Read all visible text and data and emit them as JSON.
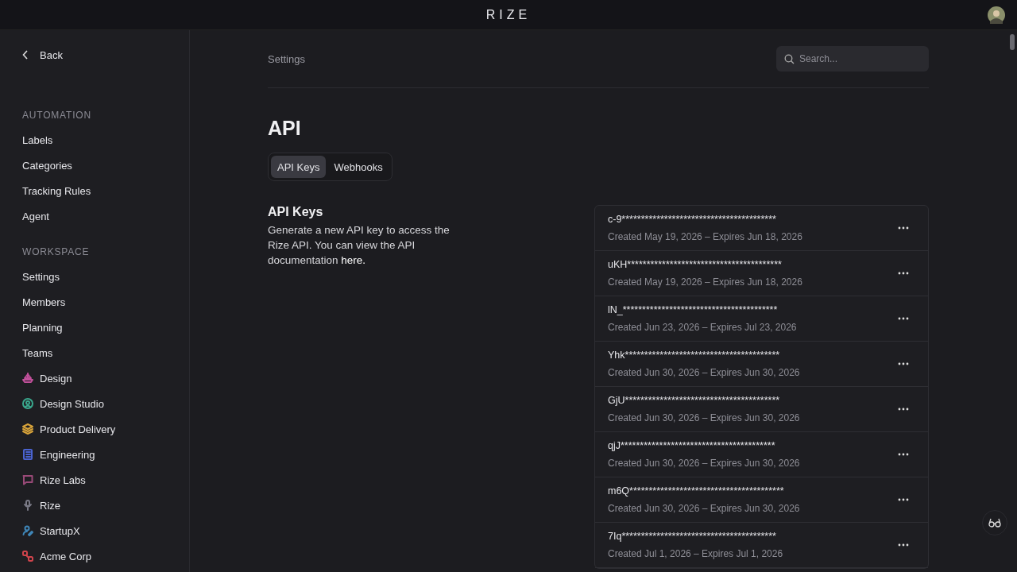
{
  "top_bar": {
    "logo": "RIZE"
  },
  "sidebar": {
    "back": "Back",
    "sections": [
      {
        "heading": "AUTOMATION",
        "items": [
          {
            "label": "Labels"
          },
          {
            "label": "Categories"
          },
          {
            "label": "Tracking Rules"
          },
          {
            "label": "Agent"
          }
        ]
      },
      {
        "heading": "WORKSPACE",
        "items": [
          {
            "label": "Settings"
          },
          {
            "label": "Members"
          },
          {
            "label": "Planning"
          },
          {
            "label": "Teams"
          },
          {
            "label": "Design",
            "kind": "boat",
            "color": "#c0509a"
          },
          {
            "label": "Design Studio",
            "kind": "person",
            "color": "#3aa98e"
          },
          {
            "label": "Product Delivery",
            "kind": "layers",
            "color": "#d9a43a"
          },
          {
            "label": "Engineering",
            "kind": "notebook",
            "color": "#4a63d0"
          },
          {
            "label": "Rize Labs",
            "kind": "chat",
            "color": "#9a4a78"
          },
          {
            "label": "Rize",
            "kind": "mic",
            "color": "#7a7a86"
          },
          {
            "label": "StartupX",
            "kind": "user-edit",
            "color": "#3f86b8"
          },
          {
            "label": "Acme Corp",
            "kind": "link",
            "color": "#d0444c"
          }
        ]
      }
    ]
  },
  "breadcrumb": "Settings",
  "search": {
    "placeholder": "Search..."
  },
  "title": "API",
  "tabs": [
    {
      "label": "API Keys",
      "selected": true
    },
    {
      "label": "Webhooks",
      "selected": false
    }
  ],
  "section": {
    "heading": "API Keys",
    "description": "Generate a new API key to access the Rize API. You can view the API documentation ",
    "link": "here."
  },
  "keys": [
    {
      "key": "c-9****************************************",
      "dates": "Created May 19, 2026 – Expires Jun 18, 2026"
    },
    {
      "key": "uKH****************************************",
      "dates": "Created May 19, 2026 – Expires Jun 18, 2026"
    },
    {
      "key": "lN_****************************************",
      "dates": "Created Jun 23, 2026 – Expires Jul 23, 2026"
    },
    {
      "key": "Yhk****************************************",
      "dates": "Created Jun 30, 2026 – Expires Jun 30, 2026"
    },
    {
      "key": "GjU****************************************",
      "dates": "Created Jun 30, 2026 – Expires Jun 30, 2026"
    },
    {
      "key": "qjJ****************************************",
      "dates": "Created Jun 30, 2026 – Expires Jun 30, 2026"
    },
    {
      "key": "m6Q****************************************",
      "dates": "Created Jun 30, 2026 – Expires Jun 30, 2026"
    },
    {
      "key": "7Iq****************************************",
      "dates": "Created Jul 1, 2026 – Expires Jul 1, 2026"
    }
  ]
}
